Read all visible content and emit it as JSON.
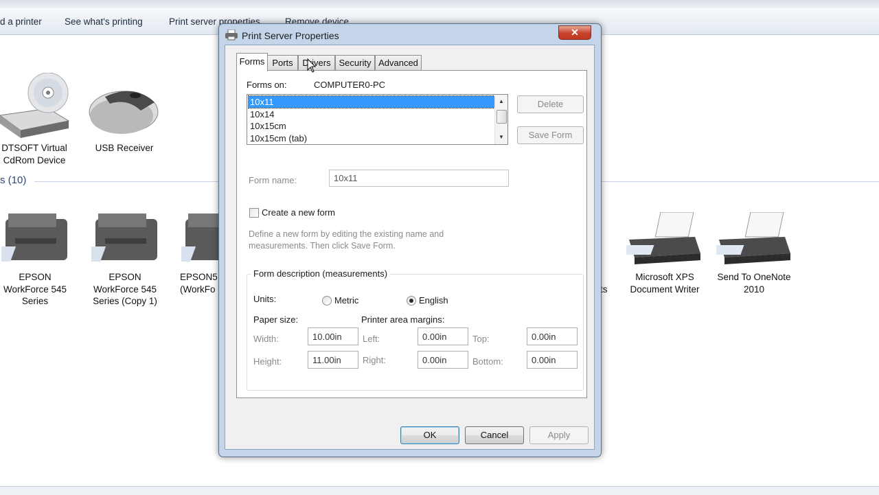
{
  "explorer": {
    "commands": [
      "d a printer",
      "See what's printing",
      "Print server properties",
      "Remove device"
    ],
    "devices": [
      {
        "label": "DTSOFT Virtual CdRom Device",
        "icon": "cd-drive-icon"
      },
      {
        "label": "USB Receiver",
        "icon": "mouse-icon"
      }
    ],
    "printers_section": "s (10)",
    "printers": [
      {
        "label": "EPSON WorkForce 545 Series"
      },
      {
        "label": "EPSON WorkForce 545 Series (Copy 1)"
      },
      {
        "label": "EPSON5 (WorkFo"
      },
      {
        "label": "ts"
      },
      {
        "label": "Microsoft XPS Document Writer"
      },
      {
        "label": "Send To OneNote 2010"
      }
    ]
  },
  "dialog": {
    "title": "Print Server Properties",
    "close_label": "✕",
    "tabs": [
      "Forms",
      "Ports",
      "Drivers",
      "Security",
      "Advanced"
    ],
    "active_tab": "Forms",
    "forms_on_label": "Forms on:",
    "computer_name": "COMPUTER0-PC",
    "forms_list": [
      "10x11",
      "10x14",
      "10x15cm",
      "10x15cm (tab)"
    ],
    "selected_form": "10x11",
    "delete_label": "Delete",
    "save_form_label": "Save Form",
    "form_name_label": "Form name:",
    "form_name_value": "10x11",
    "create_new_form_label": "Create a new form",
    "create_new_form_checked": false,
    "help_text": "Define a new form by editing the existing name and measurements. Then click Save Form.",
    "description_group": "Form description (measurements)",
    "units_label": "Units:",
    "unit_metric": "Metric",
    "unit_english": "English",
    "selected_unit": "English",
    "paper_size_label": "Paper size:",
    "margins_label": "Printer area margins:",
    "width_label": "Width:",
    "width_value": "10.00in",
    "height_label": "Height:",
    "height_value": "11.00in",
    "left_label": "Left:",
    "left_value": "0.00in",
    "right_label": "Right:",
    "right_value": "0.00in",
    "top_label": "Top:",
    "top_value": "0.00in",
    "bottom_label": "Bottom:",
    "bottom_value": "0.00in",
    "ok_label": "OK",
    "cancel_label": "Cancel",
    "apply_label": "Apply"
  },
  "colors": {
    "selection": "#3399ff",
    "dialog_frame": "#c4d5ea",
    "close_red": "#c7422b"
  }
}
